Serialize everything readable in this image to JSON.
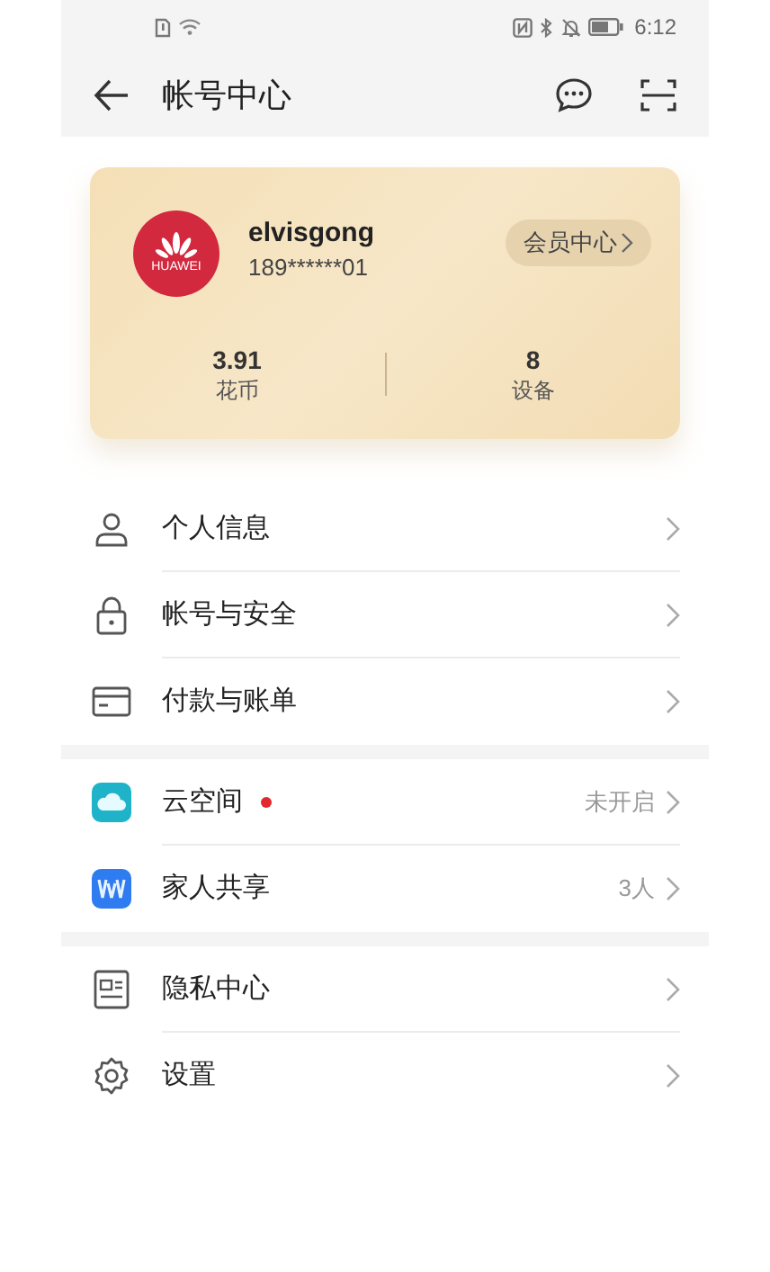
{
  "status_bar": {
    "time": "6:12"
  },
  "header": {
    "title": "帐号中心"
  },
  "profile_card": {
    "logo_text": "HUAWEI",
    "name": "elvisgong",
    "phone": "189******01",
    "member_button": "会员中心",
    "stats": [
      {
        "value": "3.91",
        "label": "花币"
      },
      {
        "value": "8",
        "label": "设备"
      }
    ]
  },
  "menu_groups": [
    {
      "items": [
        {
          "label": "个人信息",
          "new_dot": false
        },
        {
          "label": "帐号与安全",
          "new_dot": false
        },
        {
          "label": "付款与账单",
          "new_dot": false
        }
      ]
    },
    {
      "items": [
        {
          "label": "云空间",
          "new_dot": true,
          "value": "未开启"
        },
        {
          "label": "家人共享",
          "new_dot": false,
          "value": "3人"
        }
      ]
    },
    {
      "items": [
        {
          "label": "隐私中心",
          "new_dot": false
        },
        {
          "label": "设置",
          "new_dot": false
        }
      ]
    }
  ]
}
